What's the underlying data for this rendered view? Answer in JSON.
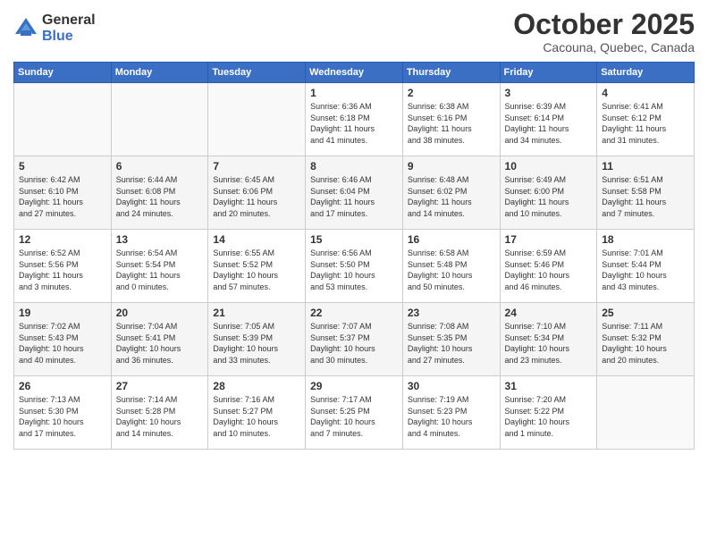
{
  "header": {
    "logo_line1": "General",
    "logo_line2": "Blue",
    "month": "October 2025",
    "location": "Cacouna, Quebec, Canada"
  },
  "days_of_week": [
    "Sunday",
    "Monday",
    "Tuesday",
    "Wednesday",
    "Thursday",
    "Friday",
    "Saturday"
  ],
  "weeks": [
    [
      {
        "day": "",
        "info": ""
      },
      {
        "day": "",
        "info": ""
      },
      {
        "day": "",
        "info": ""
      },
      {
        "day": "1",
        "info": "Sunrise: 6:36 AM\nSunset: 6:18 PM\nDaylight: 11 hours\nand 41 minutes."
      },
      {
        "day": "2",
        "info": "Sunrise: 6:38 AM\nSunset: 6:16 PM\nDaylight: 11 hours\nand 38 minutes."
      },
      {
        "day": "3",
        "info": "Sunrise: 6:39 AM\nSunset: 6:14 PM\nDaylight: 11 hours\nand 34 minutes."
      },
      {
        "day": "4",
        "info": "Sunrise: 6:41 AM\nSunset: 6:12 PM\nDaylight: 11 hours\nand 31 minutes."
      }
    ],
    [
      {
        "day": "5",
        "info": "Sunrise: 6:42 AM\nSunset: 6:10 PM\nDaylight: 11 hours\nand 27 minutes."
      },
      {
        "day": "6",
        "info": "Sunrise: 6:44 AM\nSunset: 6:08 PM\nDaylight: 11 hours\nand 24 minutes."
      },
      {
        "day": "7",
        "info": "Sunrise: 6:45 AM\nSunset: 6:06 PM\nDaylight: 11 hours\nand 20 minutes."
      },
      {
        "day": "8",
        "info": "Sunrise: 6:46 AM\nSunset: 6:04 PM\nDaylight: 11 hours\nand 17 minutes."
      },
      {
        "day": "9",
        "info": "Sunrise: 6:48 AM\nSunset: 6:02 PM\nDaylight: 11 hours\nand 14 minutes."
      },
      {
        "day": "10",
        "info": "Sunrise: 6:49 AM\nSunset: 6:00 PM\nDaylight: 11 hours\nand 10 minutes."
      },
      {
        "day": "11",
        "info": "Sunrise: 6:51 AM\nSunset: 5:58 PM\nDaylight: 11 hours\nand 7 minutes."
      }
    ],
    [
      {
        "day": "12",
        "info": "Sunrise: 6:52 AM\nSunset: 5:56 PM\nDaylight: 11 hours\nand 3 minutes."
      },
      {
        "day": "13",
        "info": "Sunrise: 6:54 AM\nSunset: 5:54 PM\nDaylight: 11 hours\nand 0 minutes."
      },
      {
        "day": "14",
        "info": "Sunrise: 6:55 AM\nSunset: 5:52 PM\nDaylight: 10 hours\nand 57 minutes."
      },
      {
        "day": "15",
        "info": "Sunrise: 6:56 AM\nSunset: 5:50 PM\nDaylight: 10 hours\nand 53 minutes."
      },
      {
        "day": "16",
        "info": "Sunrise: 6:58 AM\nSunset: 5:48 PM\nDaylight: 10 hours\nand 50 minutes."
      },
      {
        "day": "17",
        "info": "Sunrise: 6:59 AM\nSunset: 5:46 PM\nDaylight: 10 hours\nand 46 minutes."
      },
      {
        "day": "18",
        "info": "Sunrise: 7:01 AM\nSunset: 5:44 PM\nDaylight: 10 hours\nand 43 minutes."
      }
    ],
    [
      {
        "day": "19",
        "info": "Sunrise: 7:02 AM\nSunset: 5:43 PM\nDaylight: 10 hours\nand 40 minutes."
      },
      {
        "day": "20",
        "info": "Sunrise: 7:04 AM\nSunset: 5:41 PM\nDaylight: 10 hours\nand 36 minutes."
      },
      {
        "day": "21",
        "info": "Sunrise: 7:05 AM\nSunset: 5:39 PM\nDaylight: 10 hours\nand 33 minutes."
      },
      {
        "day": "22",
        "info": "Sunrise: 7:07 AM\nSunset: 5:37 PM\nDaylight: 10 hours\nand 30 minutes."
      },
      {
        "day": "23",
        "info": "Sunrise: 7:08 AM\nSunset: 5:35 PM\nDaylight: 10 hours\nand 27 minutes."
      },
      {
        "day": "24",
        "info": "Sunrise: 7:10 AM\nSunset: 5:34 PM\nDaylight: 10 hours\nand 23 minutes."
      },
      {
        "day": "25",
        "info": "Sunrise: 7:11 AM\nSunset: 5:32 PM\nDaylight: 10 hours\nand 20 minutes."
      }
    ],
    [
      {
        "day": "26",
        "info": "Sunrise: 7:13 AM\nSunset: 5:30 PM\nDaylight: 10 hours\nand 17 minutes."
      },
      {
        "day": "27",
        "info": "Sunrise: 7:14 AM\nSunset: 5:28 PM\nDaylight: 10 hours\nand 14 minutes."
      },
      {
        "day": "28",
        "info": "Sunrise: 7:16 AM\nSunset: 5:27 PM\nDaylight: 10 hours\nand 10 minutes."
      },
      {
        "day": "29",
        "info": "Sunrise: 7:17 AM\nSunset: 5:25 PM\nDaylight: 10 hours\nand 7 minutes."
      },
      {
        "day": "30",
        "info": "Sunrise: 7:19 AM\nSunset: 5:23 PM\nDaylight: 10 hours\nand 4 minutes."
      },
      {
        "day": "31",
        "info": "Sunrise: 7:20 AM\nSunset: 5:22 PM\nDaylight: 10 hours\nand 1 minute."
      },
      {
        "day": "",
        "info": ""
      }
    ]
  ]
}
